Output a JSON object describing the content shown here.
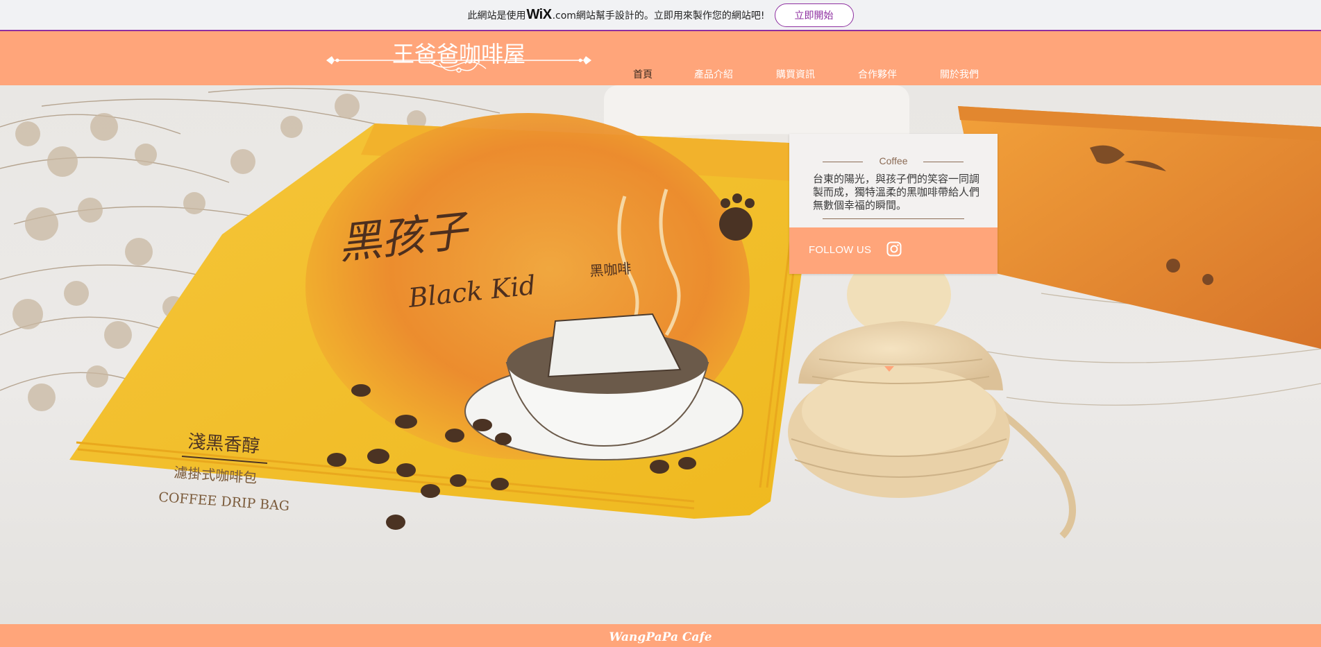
{
  "promo": {
    "text_before": "此網站是使用",
    "wix_logo": "WiX",
    "text_after": ".com網站幫手設計的。立即用來製作您的網站吧!",
    "button_label": "立即開始",
    "accent": "#8e2fa0"
  },
  "header": {
    "site_title": "王爸爸咖啡屋",
    "background": "#ffa57a",
    "nav": [
      {
        "label": "首頁",
        "active": true
      },
      {
        "label": "產品介紹",
        "active": false
      },
      {
        "label": "購買資訊",
        "active": false
      },
      {
        "label": "合作夥伴",
        "active": false
      },
      {
        "label": "關於我們",
        "active": false
      }
    ]
  },
  "hero": {
    "packet": {
      "brand_script": "黑孩子",
      "brand_cn": "黑咖啡",
      "brand_en": "Black Kid",
      "flavor": "淺黑香醇",
      "type_cn": "濾掛式咖啡包",
      "type_en": "COFFEE DRIP BAG"
    }
  },
  "card": {
    "heading": "Coffee",
    "body": "台東的陽光，與孩子們的笑容一同調製而成，獨特溫柔的黑咖啡帶給人們無數個幸福的瞬間。",
    "follow_label": "FOLLOW US",
    "social_icon": "instagram-icon"
  },
  "footer": {
    "text": "WangPaPa Cafe"
  }
}
